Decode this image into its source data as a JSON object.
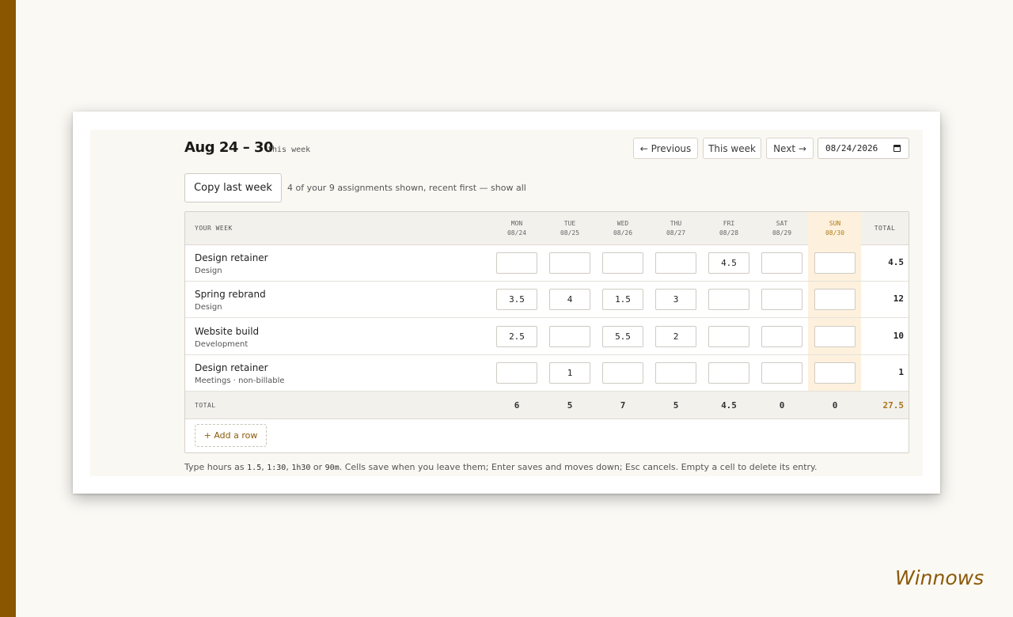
{
  "brand": "Winnows",
  "header": {
    "title": "Aug 24 – 30",
    "subtitle": "this week",
    "prev_label": "← Previous",
    "this_week_label": "This week",
    "next_label": "Next →",
    "date_value": "08/24/2026"
  },
  "toolbar": {
    "copy_label": "Copy last week",
    "assignments_note": "4 of your 9 assignments shown, recent first — show all"
  },
  "table": {
    "header_label": "YOUR WEEK",
    "days": [
      {
        "dow": "MON",
        "date": "08/24"
      },
      {
        "dow": "TUE",
        "date": "08/25"
      },
      {
        "dow": "WED",
        "date": "08/26"
      },
      {
        "dow": "THU",
        "date": "08/27"
      },
      {
        "dow": "FRI",
        "date": "08/28"
      },
      {
        "dow": "SAT",
        "date": "08/29"
      },
      {
        "dow": "SUN",
        "date": "08/30"
      }
    ],
    "total_label": "TOTAL",
    "rows": [
      {
        "name": "Design retainer",
        "sub": "Design",
        "cells": [
          "",
          "",
          "",
          "",
          "4.5",
          "",
          ""
        ],
        "total": "4.5"
      },
      {
        "name": "Spring rebrand",
        "sub": "Design",
        "cells": [
          "3.5",
          "4",
          "1.5",
          "3",
          "",
          "",
          ""
        ],
        "total": "12"
      },
      {
        "name": "Website build",
        "sub": "Development",
        "cells": [
          "2.5",
          "",
          "5.5",
          "2",
          "",
          "",
          ""
        ],
        "total": "10"
      },
      {
        "name": "Design retainer",
        "sub": "Meetings · non-billable",
        "cells": [
          "",
          "1",
          "",
          "",
          "",
          "",
          ""
        ],
        "total": "1"
      }
    ],
    "footer_label": "TOTAL",
    "day_totals": [
      "6",
      "5",
      "7",
      "5",
      "4.5",
      "0",
      "0"
    ],
    "grand_total": "27.5",
    "add_row_label": "+ Add a row"
  },
  "help": {
    "prefix": "Type hours as ",
    "ex1": "1.5",
    "sep1": ", ",
    "ex2": "1:30",
    "sep2": ", ",
    "ex3": "1h30",
    "sep3": " or ",
    "ex4": "90m",
    "suffix": ". Cells save when you leave them; Enter saves and moves down; Esc cancels. Empty a cell to delete its entry."
  }
}
